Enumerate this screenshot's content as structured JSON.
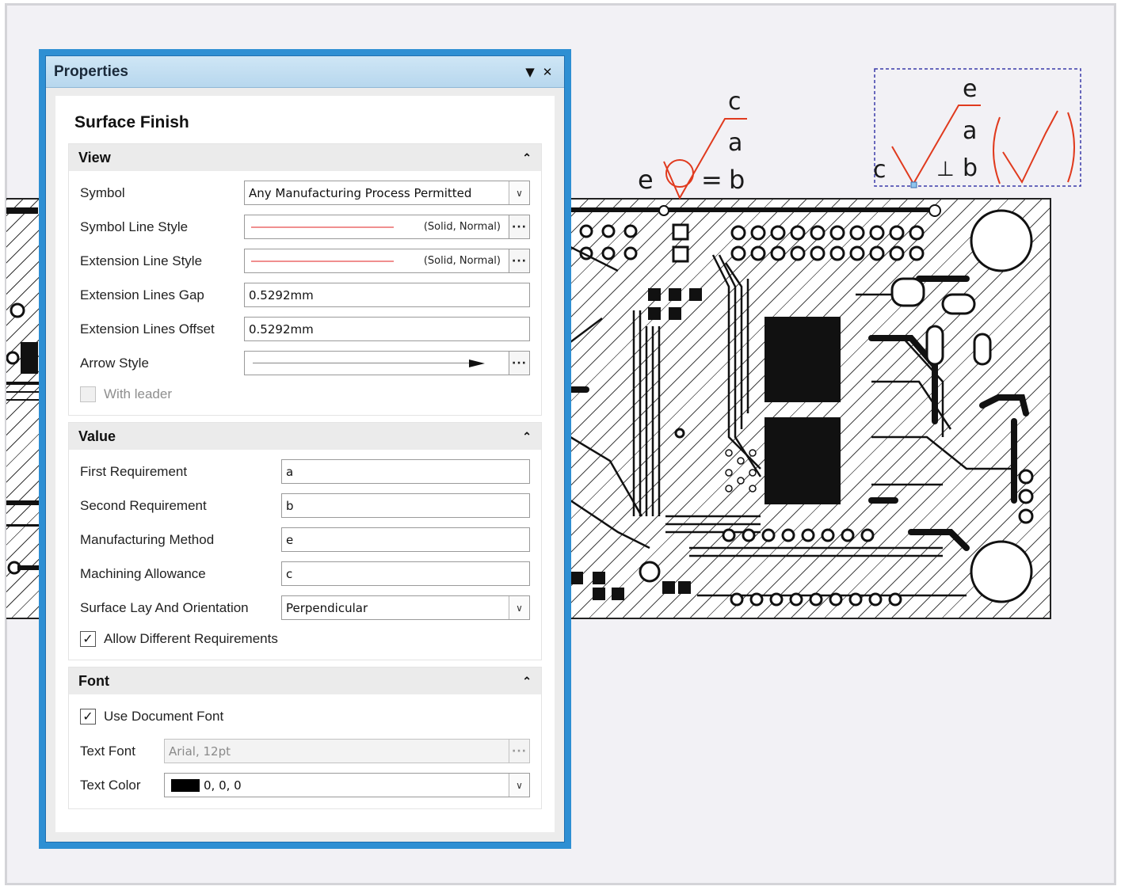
{
  "panel": {
    "title": "Properties",
    "menu_glyph": "▼",
    "close_glyph": "✕",
    "heading": "Surface Finish"
  },
  "view": {
    "title": "View",
    "collapse_glyph": "⌃",
    "symbol_label": "Symbol",
    "symbol_value": "Any Manufacturing Process Permitted",
    "symbol_line_style_label": "Symbol Line Style",
    "symbol_line_style_value": "(Solid, Normal)",
    "extension_line_style_label": "Extension Line Style",
    "extension_line_style_value": "(Solid, Normal)",
    "extension_lines_gap_label": "Extension Lines Gap",
    "extension_lines_gap_value": "0.5292mm",
    "extension_lines_offset_label": "Extension Lines Offset",
    "extension_lines_offset_value": "0.5292mm",
    "arrow_style_label": "Arrow Style",
    "with_leader_label": "With leader",
    "with_leader_checked": false
  },
  "value": {
    "title": "Value",
    "collapse_glyph": "⌃",
    "first_requirement_label": "First Requirement",
    "first_requirement_value": "a",
    "second_requirement_label": "Second Requirement",
    "second_requirement_value": "b",
    "manufacturing_method_label": "Manufacturing Method",
    "manufacturing_method_value": "e",
    "machining_allowance_label": "Machining Allowance",
    "machining_allowance_value": "c",
    "surface_lay_label": "Surface Lay And Orientation",
    "surface_lay_value": "Perpendicular",
    "allow_different_label": "Allow Different Requirements",
    "allow_different_checked": true
  },
  "font": {
    "title": "Font",
    "collapse_glyph": "⌃",
    "use_document_font_label": "Use Document Font",
    "use_document_font_checked": true,
    "text_font_label": "Text Font",
    "text_font_value": "Arial, 12pt",
    "text_color_label": "Text Color",
    "text_color_value": "0, 0, 0",
    "text_color_hex": "#000000"
  },
  "canvas": {
    "symbol1": {
      "c": "c",
      "a": "a",
      "e": "e",
      "b": "b",
      "lay": "="
    },
    "symbol2": {
      "e": "e",
      "a": "a",
      "c": "c",
      "b": "b",
      "lay": "⊥"
    }
  },
  "colors": {
    "panel_border": "#2e8fd3",
    "symbol_red": "#e03a1e",
    "selection": "#3a3aaa"
  }
}
